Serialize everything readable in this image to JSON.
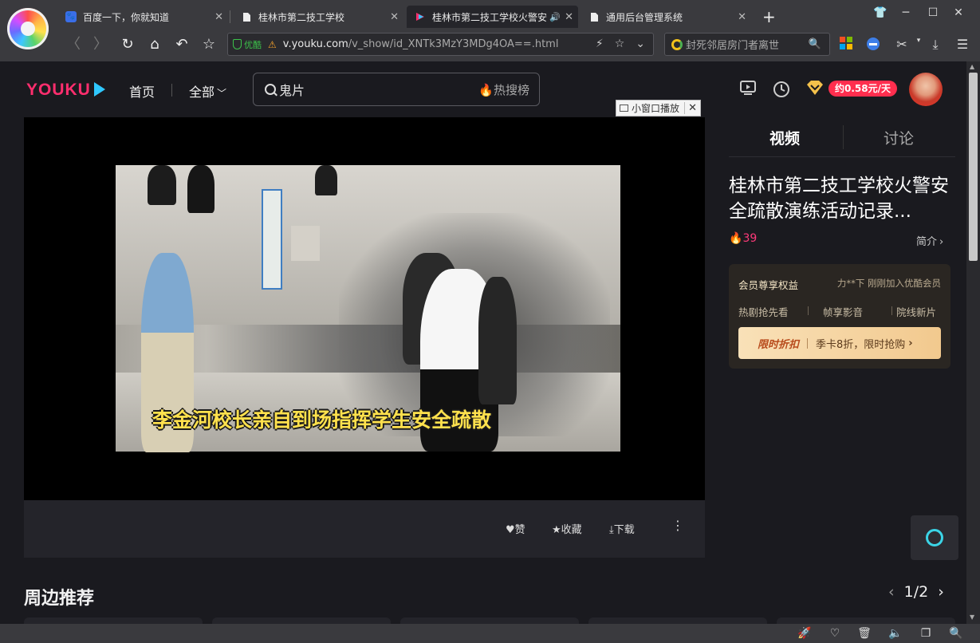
{
  "browser": {
    "tabs": [
      {
        "label": "百度一下，你就知道",
        "icon": "baidu-icon"
      },
      {
        "label": "桂林市第二技工学校",
        "icon": "page-icon"
      },
      {
        "label": "桂林市第二技工学校火警安",
        "icon": "youku-icon",
        "active": true
      },
      {
        "label": "通用后台管理系统",
        "icon": "page-icon"
      }
    ],
    "new_tab": "+",
    "url": {
      "secure_label": "优酷",
      "host": "v.youku.com",
      "path": "/v_show/id_XNTk3MzY3MDg4OA==.html"
    },
    "search_placeholder": "封死邻居房门者离世"
  },
  "youku": {
    "nav": {
      "home": "首页",
      "all": "全部"
    },
    "search": {
      "value": "鬼片",
      "hot": "热搜榜"
    },
    "vip_badge": "约0.58元/天",
    "player": {
      "mini_window": "小窗口播放",
      "subtitle": "李金河校长亲自到场指挥学生安全疏散"
    },
    "actions": {
      "like": "赞",
      "favorite": "收藏",
      "download": "下载"
    },
    "side": {
      "tab_video": "视频",
      "tab_discuss": "讨论",
      "title": "桂林市第二技工学校火警安全疏散演练活动记录...",
      "heat": "39",
      "intro": "简介"
    },
    "vip_card": {
      "title": "会员尊享权益",
      "recent": "力**下 刚刚加入优酷会员",
      "features": [
        "热剧抢先看",
        "帧享影音",
        "院线新片"
      ],
      "promo_tag": "限时折扣",
      "promo_text": "季卡8折，限时抢购"
    },
    "recommend": {
      "title": "周边推荐",
      "page": "1/2"
    }
  },
  "colors": {
    "brand_pink": "#ff2e6e",
    "brand_blue": "#2fc8ff",
    "vip_red": "#ff2e4e",
    "subtitle_yellow": "#ffe14d",
    "secure_green": "#3cc24a",
    "page_bg": "#1a1a1f"
  }
}
